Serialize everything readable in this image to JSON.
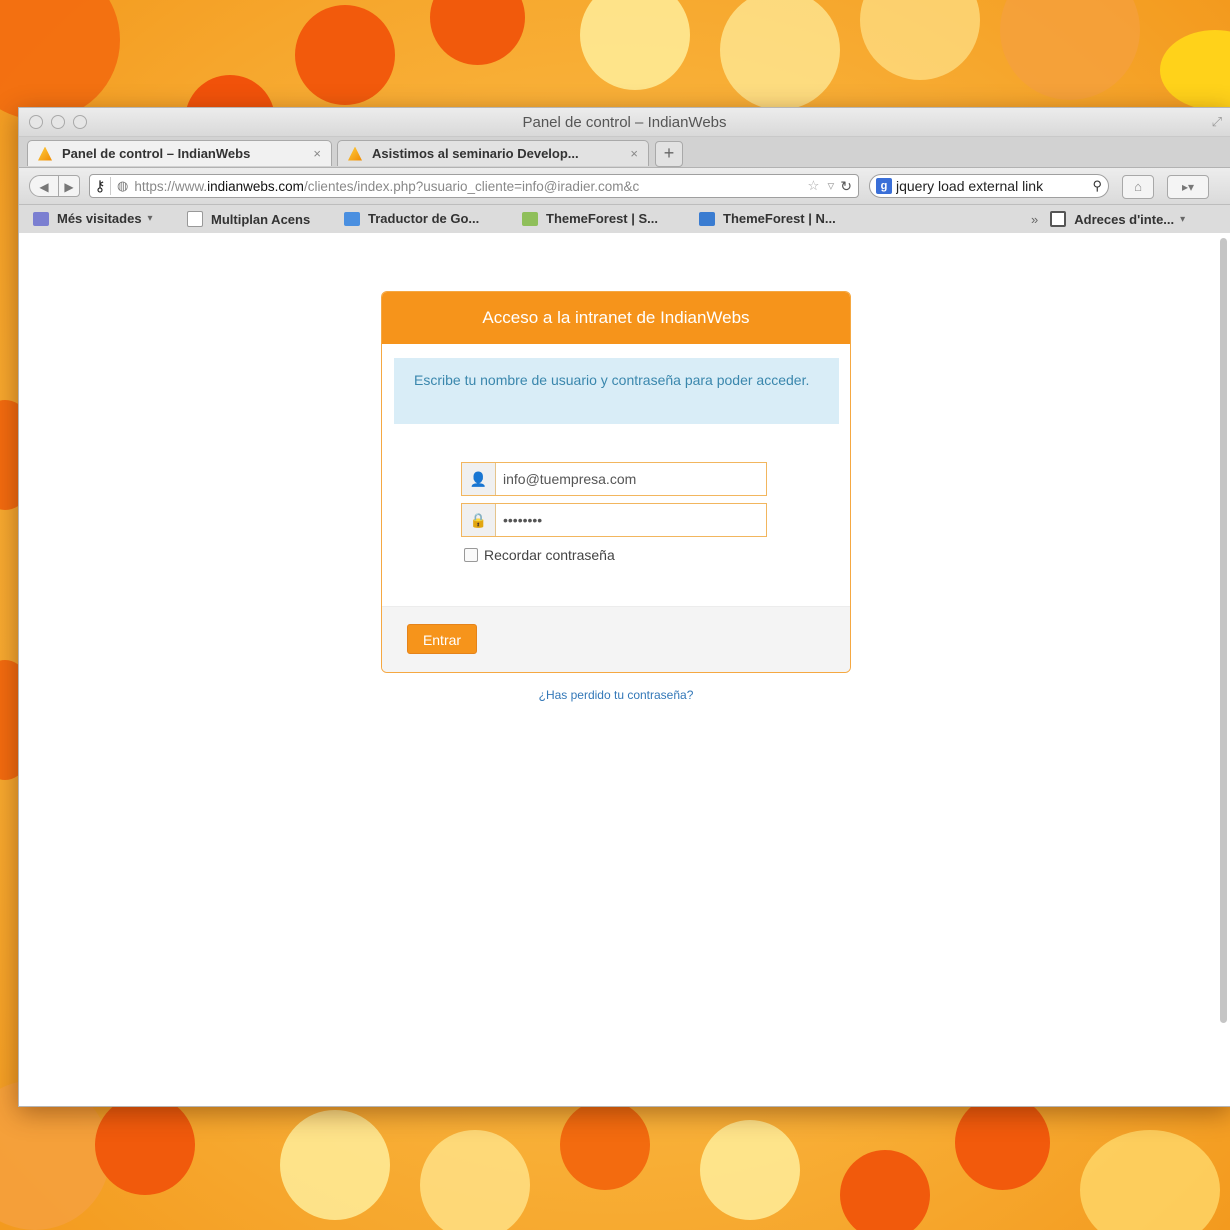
{
  "window": {
    "title": "Panel de control – IndianWebs"
  },
  "tabs": [
    {
      "label": "Panel de control – IndianWebs",
      "close": "×"
    },
    {
      "label": "Asistimos al seminario Develop...",
      "close": "×"
    }
  ],
  "newtab_label": "+",
  "toolbar": {
    "url_prefix": "https://www.",
    "url_domain": "indianwebs.com",
    "url_path": "/clientes/index.php?usuario_cliente=info@iradier.com&c",
    "search_value": "jquery load external link",
    "search_engine_icon": "google-icon"
  },
  "bookmarks": [
    {
      "label": "Més visitades",
      "icon": "folder-icon",
      "color": "#7b7fd1"
    },
    {
      "label": "Multiplan Acens",
      "icon": "page-icon",
      "color": "#ffffff"
    },
    {
      "label": "Traductor de Go...",
      "icon": "translate-icon",
      "color": "#4a8fe0"
    },
    {
      "label": "ThemeForest | S...",
      "icon": "image-icon",
      "color": "#8fbf5a"
    },
    {
      "label": "ThemeForest | N...",
      "icon": "themeforest-icon",
      "color": "#3a7cd1"
    },
    {
      "label": "Adreces d'inte...",
      "icon": "bookmarks-icon",
      "color": "#555555"
    }
  ],
  "login": {
    "heading": "Acceso a la intranet de IndianWebs",
    "info": "Escribe tu nombre de usuario y contraseña para poder acceder.",
    "username_value": "info@tuempresa.com",
    "password_value": "••••••••",
    "remember_label": "Recordar contraseña",
    "submit_label": "Entrar",
    "forgot_link": "¿Has perdido tu contraseña?"
  },
  "colors": {
    "accent": "#f6941b",
    "info_bg": "#d9edf7",
    "info_text": "#3a87ad",
    "link": "#3378b8"
  }
}
